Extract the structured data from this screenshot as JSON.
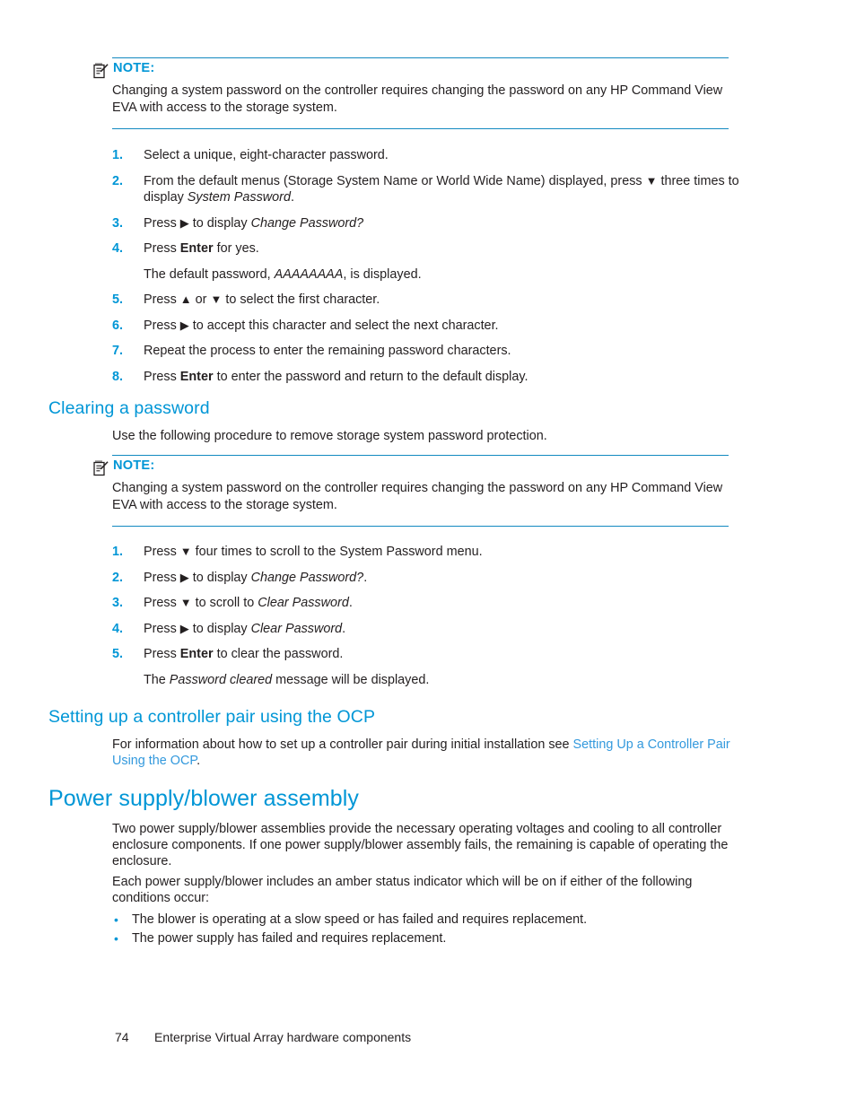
{
  "page": {
    "footer_page_number": "74",
    "footer_title": "Enterprise Virtual Array hardware components"
  },
  "colors": {
    "heading_blue": "#0096D6",
    "rule_blue": "#1289C0",
    "link_blue": "#3399DD",
    "body_text": "#231F20"
  },
  "note_1": {
    "icon": "note-pencil-icon",
    "title": "NOTE:",
    "body": "Changing a system password on the controller requires changing the password on any HP Command View EVA with access to the storage system."
  },
  "steps_changing": {
    "items": [
      {
        "num": "1.",
        "parts": [
          {
            "t": "Select a unique, eight-character password."
          }
        ]
      },
      {
        "num": "2.",
        "parts": [
          {
            "t": "From the default menus (Storage System Name or World Wide Name) displayed, press "
          },
          {
            "glyph": "▼",
            "name": "down-arrow-glyph"
          },
          {
            "t": " three times to display "
          },
          {
            "em": "System Password"
          },
          {
            "t": "."
          }
        ]
      },
      {
        "num": "3.",
        "parts": [
          {
            "t": "Press "
          },
          {
            "glyph": "▶",
            "name": "right-arrow-glyph"
          },
          {
            "t": " to display "
          },
          {
            "em": "Change Password?"
          }
        ]
      },
      {
        "num": "4.",
        "parts": [
          {
            "t": "Press "
          },
          {
            "b": "Enter"
          },
          {
            "t": " for yes."
          }
        ],
        "sub": [
          {
            "t": "The default password, "
          },
          {
            "em": "AAAAAAAA"
          },
          {
            "t": ", is displayed."
          }
        ]
      },
      {
        "num": "5.",
        "parts": [
          {
            "t": "Press "
          },
          {
            "glyph": "▲",
            "name": "up-arrow-glyph"
          },
          {
            "t": " or "
          },
          {
            "glyph": "▼",
            "name": "down-arrow-glyph"
          },
          {
            "t": " to select the first character."
          }
        ]
      },
      {
        "num": "6.",
        "parts": [
          {
            "t": "Press "
          },
          {
            "glyph": "▶",
            "name": "right-arrow-glyph"
          },
          {
            "t": " to accept this character and select the next character."
          }
        ]
      },
      {
        "num": "7.",
        "parts": [
          {
            "t": "Repeat the process to enter the remaining password characters."
          }
        ]
      },
      {
        "num": "8.",
        "parts": [
          {
            "t": "Press "
          },
          {
            "b": "Enter"
          },
          {
            "t": " to enter the password and return to the default display."
          }
        ]
      }
    ]
  },
  "section_clearing": {
    "heading": "Clearing a password",
    "intro": "Use the following procedure to remove storage system password protection."
  },
  "note_2": {
    "icon": "note-pencil-icon",
    "title": "NOTE:",
    "body": "Changing a system password on the controller requires changing the password on any HP Command View EVA with access to the storage system."
  },
  "steps_clearing": {
    "items": [
      {
        "num": "1.",
        "parts": [
          {
            "t": "Press "
          },
          {
            "glyph": "▼",
            "name": "down-arrow-glyph"
          },
          {
            "t": " four times to scroll to the System Password menu."
          }
        ]
      },
      {
        "num": "2.",
        "parts": [
          {
            "t": "Press "
          },
          {
            "glyph": "▶",
            "name": "right-arrow-glyph"
          },
          {
            "t": " to display "
          },
          {
            "em": "Change Password?"
          },
          {
            "t": "."
          }
        ]
      },
      {
        "num": "3.",
        "parts": [
          {
            "t": "Press "
          },
          {
            "glyph": "▼",
            "name": "down-arrow-glyph"
          },
          {
            "t": " to scroll to "
          },
          {
            "em": "Clear Password"
          },
          {
            "t": "."
          }
        ]
      },
      {
        "num": "4.",
        "parts": [
          {
            "t": "Press "
          },
          {
            "glyph": "▶",
            "name": "right-arrow-glyph"
          },
          {
            "t": " to display "
          },
          {
            "em": "Clear Password"
          },
          {
            "t": "."
          }
        ]
      },
      {
        "num": "5.",
        "parts": [
          {
            "t": "Press "
          },
          {
            "b": "Enter"
          },
          {
            "t": " to clear the password."
          }
        ],
        "sub": [
          {
            "t": "The "
          },
          {
            "em": "Password cleared"
          },
          {
            "t": " message will be displayed."
          }
        ]
      }
    ]
  },
  "section_ocp": {
    "heading": "Setting up a controller pair using the OCP",
    "body_prefix": "For information about how to set up a controller pair during initial installation see ",
    "link_text": "Setting Up a Controller Pair Using the OCP",
    "body_suffix": "."
  },
  "section_power": {
    "heading": "Power supply/blower assembly",
    "paragraph_1": "Two power supply/blower assemblies provide the necessary operating voltages and cooling to all controller enclosure components. If one power supply/blower assembly fails, the remaining is capable of operating the enclosure.",
    "paragraph_2": "Each power supply/blower includes an amber status indicator which will be on if either of the following conditions occur:",
    "bullets": [
      "The blower is operating at a slow speed or has failed and requires replacement.",
      "The power supply has failed and requires replacement."
    ]
  }
}
